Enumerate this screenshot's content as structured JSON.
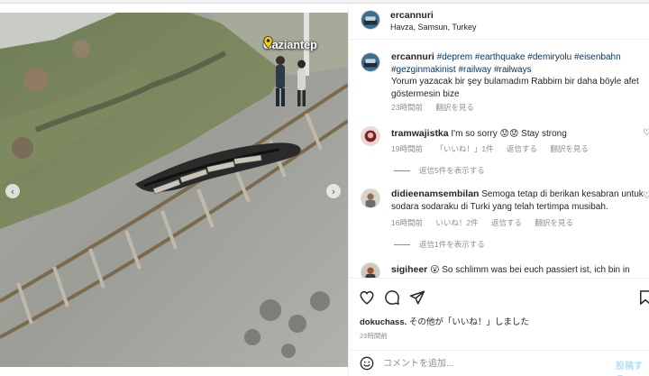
{
  "post": {
    "username": "ercannuri",
    "location": "Havza, Samsun, Turkey"
  },
  "media": {
    "location_tag": "Gaziantep",
    "description_icon": "pin-icon"
  },
  "caption": {
    "username": "ercannuri",
    "hashtags_line1": "#deprem #earthquake #demiryolu #eisenbahn",
    "hashtags_line2": "#gezginmakinist #railway #railways",
    "text_line1": "Yorum yazacak bir şey bulamadım Rabbim bir daha böyle afet",
    "text_line2": "göstermesin bize",
    "time": "23時間前",
    "translate": "翻訳を見る"
  },
  "comments": [
    {
      "username": "tramwajistka",
      "text": "I'm so sorry 😟😟 Stay strong",
      "time": "19時間前",
      "likes": "「いいね！」1件",
      "reply": "返信する",
      "translate": "翻訳を見る",
      "view_replies": "返信5件を表示する"
    },
    {
      "username": "didieenamsembilan",
      "text_line1": "Semoga tetap di berikan kesabran untuk",
      "text_line2": "sodara sodaraku di Turki yang telah tertimpa musibah.",
      "time": "16時間前",
      "likes": "いいね！2件",
      "reply": "返信する",
      "translate": "翻訳を見る",
      "view_replies": "返信1件を表示する"
    },
    {
      "username": "sigiheer",
      "text": "😮 So schlimm was bei euch passiert ist, ich bin in"
    }
  ],
  "likes_line": {
    "username": "dokuchass.",
    "suffix": "その他が「いいね！」しました"
  },
  "post_time": "23時間前",
  "add_comment": {
    "placeholder": "コメントを追加...",
    "post_label": "投稿する"
  },
  "colors": {
    "hashtag": "#00376b",
    "muted": "#8e8e8e",
    "post_button": "#b2dffc"
  }
}
